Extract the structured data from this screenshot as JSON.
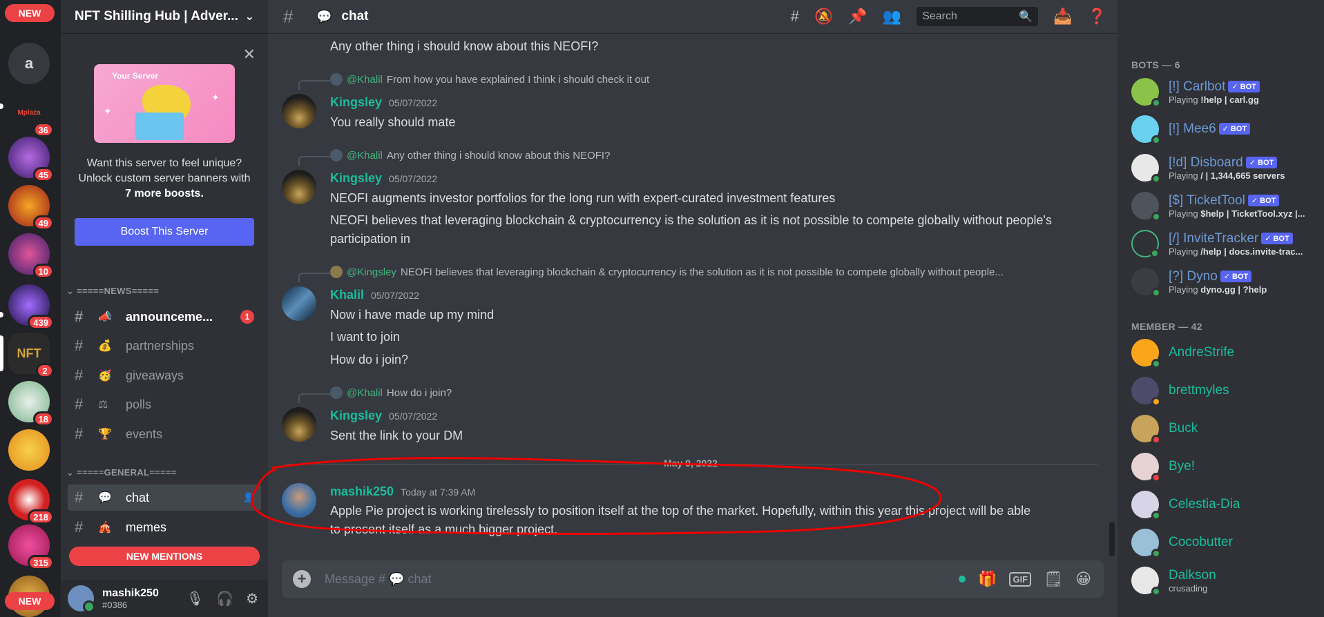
{
  "rail": {
    "new_top": "NEW",
    "new_bottom": "NEW",
    "dm_letter": "a",
    "servers": [
      {
        "label": "Mplaza",
        "badge": "36"
      },
      {
        "label": "",
        "badge": "45"
      },
      {
        "label": "",
        "badge": "49"
      },
      {
        "label": "",
        "badge": "10"
      },
      {
        "label": "",
        "badge": "439"
      },
      {
        "label": "NFT",
        "badge": "2"
      },
      {
        "label": "",
        "badge": "18"
      },
      {
        "label": "",
        "badge": ""
      },
      {
        "label": "",
        "badge": "218"
      },
      {
        "label": "",
        "badge": "315"
      }
    ]
  },
  "sidebar": {
    "server_name": "NFT Shilling Hub | Adver...",
    "promo": {
      "banner_title": "Your Server",
      "line1": "Want this server to feel unique?",
      "line2": "Unlock custom server banners with",
      "line3": "7 more boosts.",
      "button": "Boost This Server"
    },
    "cat_news": "=====NEWS=====",
    "cat_general": "=====GENERAL=====",
    "channels_news": [
      {
        "emoji": "📣",
        "name": "announceme...",
        "badge": "1"
      },
      {
        "emoji": "💰",
        "name": "partnerships",
        "badge": ""
      },
      {
        "emoji": "🥳",
        "name": "giveaways",
        "badge": ""
      },
      {
        "emoji": "⚖",
        "name": "polls",
        "badge": ""
      },
      {
        "emoji": "🏆",
        "name": "events",
        "badge": ""
      }
    ],
    "channels_general": [
      {
        "emoji": "💬",
        "name": "chat"
      },
      {
        "emoji": "🎪",
        "name": "memes"
      }
    ],
    "new_mentions": "NEW MENTIONS",
    "user": {
      "name": "mashik250",
      "tag": "#0386"
    }
  },
  "header": {
    "channel_emoji": "💬",
    "channel_name": "chat",
    "search_placeholder": "Search"
  },
  "messages": {
    "top_line": "Any other thing i should know about this NEOFI?",
    "m1": {
      "reply_name": "@Khalil",
      "reply_text": "From how you have explained  I think i should check it out",
      "author": "Kingsley",
      "time": "05/07/2022",
      "lines": [
        "You really should mate"
      ]
    },
    "m2": {
      "reply_name": "@Khalil",
      "reply_text": "Any other thing i should know about this NEOFI?",
      "author": "Kingsley",
      "time": "05/07/2022",
      "lines": [
        "NEOFI augments investor portfolios for the long run with expert-curated investment features",
        "NEOFI believes that leveraging blockchain & cryptocurrency is the solution as it is not possible to compete globally without people's participation in"
      ]
    },
    "m3": {
      "reply_name": "@Kingsley",
      "reply_text": "NEOFI believes that leveraging blockchain & cryptocurrency is the solution as it is not possible to compete globally without people...",
      "author": "Khalil",
      "time": "05/07/2022",
      "lines": [
        "Now i have made up my mind",
        "I want to join",
        "How do i join?"
      ]
    },
    "m4": {
      "reply_name": "@Khalil",
      "reply_text": "How do i join?",
      "author": "Kingsley",
      "time": "05/07/2022",
      "lines": [
        "Sent the link to your DM"
      ]
    },
    "date_divider": "May 9, 2022",
    "m5": {
      "author": "mashik250",
      "time": "Today at 7:39 AM",
      "text": "Apple Pie project is working tirelessly to position itself at the top of the market. Hopefully, within this year this project will be able to present itself as a much bigger project."
    }
  },
  "composer": {
    "placeholder": "Message # 💬 chat",
    "gif": "GIF"
  },
  "members": {
    "bots_caption": "BOTS — 6",
    "members_caption": "MEMBER — 42",
    "bot_badge": "✓ BOT",
    "bots": [
      {
        "name": "[!] Carlbot",
        "act_pre": "Playing ",
        "act": "!help | carl.gg",
        "color": "#8bc34a"
      },
      {
        "name": "[!] Mee6",
        "act_pre": "",
        "act": "",
        "color": "#6ad1f0"
      },
      {
        "name": "[!d] Disboard",
        "act_pre": "Playing ",
        "act": "/ | 1,344,665 servers",
        "color": "#e8e8e8"
      },
      {
        "name": "[$] TicketTool",
        "act_pre": "Playing ",
        "act": "$help | TicketTool.xyz |...",
        "color": "#4f545c"
      },
      {
        "name": "[/] InviteTracker",
        "act_pre": "Playing ",
        "act": "/help | docs.invite-trac...",
        "color": "#2f3136"
      },
      {
        "name": "[?] Dyno",
        "act_pre": "Playing ",
        "act": "dyno.gg | ?help",
        "color": "#3a3d44"
      }
    ],
    "people": [
      {
        "name": "AndreStrife",
        "sub": "",
        "color": "#faa61a",
        "status": "online"
      },
      {
        "name": "brettmyles",
        "sub": "",
        "color": "#4e4a6a",
        "status": "idle"
      },
      {
        "name": "Buck",
        "sub": "",
        "color": "#c8a35a",
        "status": "dnd"
      },
      {
        "name": "Bye!",
        "sub": "",
        "color": "#e7d3d3",
        "status": "dnd"
      },
      {
        "name": "Celestia-Dia",
        "sub": "",
        "color": "#d8d4e8",
        "status": "online"
      },
      {
        "name": "Cocobutter",
        "sub": "",
        "color": "#9ac0d8",
        "status": "online"
      },
      {
        "name": "Dalkson",
        "sub": "crusading",
        "color": "#e8e8e8",
        "status": "online"
      }
    ]
  }
}
